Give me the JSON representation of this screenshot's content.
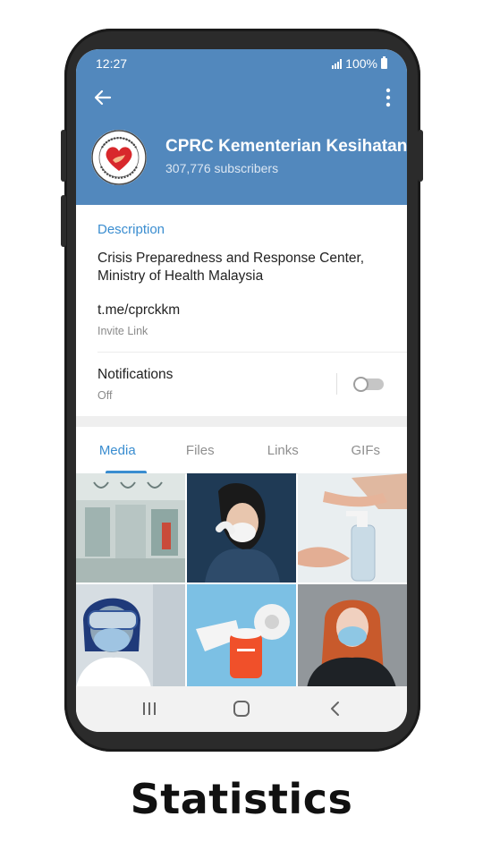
{
  "status_bar": {
    "time": "12:27",
    "battery": "100%"
  },
  "header": {
    "channel_title": "CPRC Kementerian Kesihatan Malaysia",
    "subscribers": "307,776 subscribers",
    "avatar_text": "Kami Jadi Membantu · KEMENTERIAN KESIHATAN MALAYSIA"
  },
  "description": {
    "heading": "Description",
    "text": "Crisis Preparedness and Response Center, Ministry of Health Malaysia",
    "link": "t.me/cprckkm",
    "link_label": "Invite Link"
  },
  "notifications": {
    "title": "Notifications",
    "status": "Off",
    "enabled": false
  },
  "tabs": [
    {
      "label": "Media",
      "active": true
    },
    {
      "label": "Files",
      "active": false
    },
    {
      "label": "Links",
      "active": false
    },
    {
      "label": "GIFs",
      "active": false
    }
  ],
  "media_grid": [
    "bus-interior-photo",
    "woman-wearing-mask-photo",
    "hand-sanitizer-photo",
    "health-worker-ppe-photo",
    "tissue-rolls-photo",
    "woman-with-mask-photo"
  ],
  "caption": "Statistics",
  "colors": {
    "header": "#5288bd",
    "accent": "#3a8dd0",
    "caption": "#111111"
  }
}
